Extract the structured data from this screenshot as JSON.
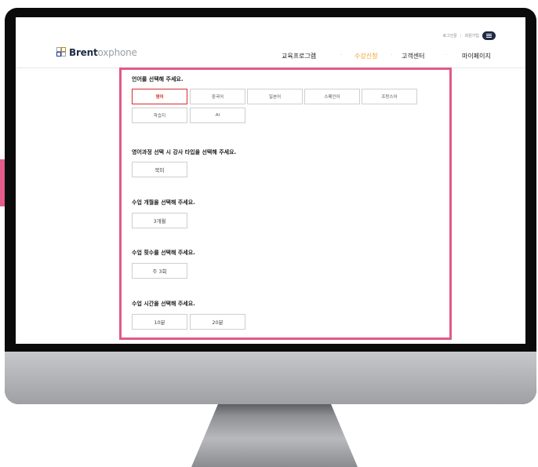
{
  "header": {
    "logo_bold": "Brent",
    "logo_rest": "oxphone",
    "util": {
      "login": "로그인문",
      "signup": "회원가입"
    },
    "nav": [
      {
        "label": "교육프로그램",
        "active": false
      },
      {
        "label": "수강신청",
        "active": true
      },
      {
        "label": "고객센터",
        "active": false
      },
      {
        "label": "마이페이지",
        "active": false
      }
    ],
    "nav_separator": "·"
  },
  "sections": {
    "language": {
      "title": "언어를 선택해 주세요.",
      "options": [
        "영어",
        "중국어",
        "일본어",
        "스페인어",
        "프랑스어",
        "학습지",
        "AI"
      ],
      "selected": "영어"
    },
    "teacher": {
      "title": "영어과정 선택 시 강사 타입을 선택해 주세요.",
      "options": [
        "북미"
      ]
    },
    "months": {
      "title": "수업 개월을 선택해 주세요.",
      "options": [
        "3개월"
      ]
    },
    "frequency": {
      "title": "수업 횟수를 선택해 주세요.",
      "options": [
        "주 3회"
      ]
    },
    "duration": {
      "title": "수업 시간을 선택해 주세요.",
      "options": [
        "10분",
        "20분"
      ]
    }
  },
  "colors": {
    "highlight_border": "#e05a87",
    "active_nav": "#f0a020",
    "selected_option": "#d62c2c",
    "brand_navy": "#1f2a44"
  }
}
